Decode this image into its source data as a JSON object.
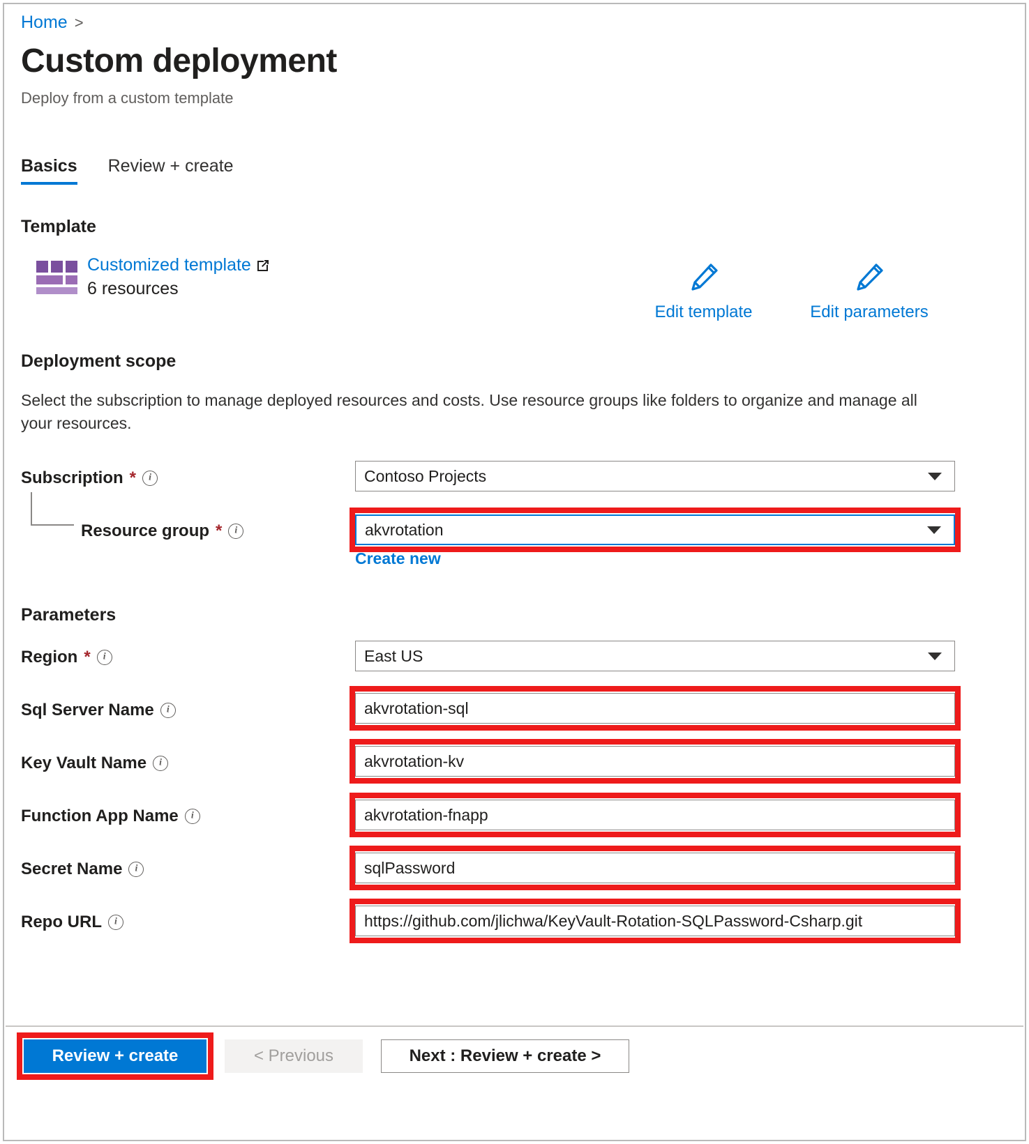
{
  "breadcrumb": {
    "home_label": "Home",
    "separator": ">"
  },
  "header": {
    "title": "Custom deployment",
    "subtitle": "Deploy from a custom template"
  },
  "tabs": [
    {
      "label": "Basics",
      "selected": true
    },
    {
      "label": "Review + create",
      "selected": false
    }
  ],
  "template_section": {
    "heading": "Template",
    "icon_name": "customized-template-icon",
    "link_label": "Customized template",
    "external_link_icon": "external-link-icon",
    "resources_count_label": "6 resources",
    "actions": [
      {
        "icon": "pencil-icon",
        "label": "Edit template"
      },
      {
        "icon": "pencil-icon",
        "label": "Edit parameters"
      }
    ]
  },
  "deployment_scope": {
    "heading": "Deployment scope",
    "description": "Select the subscription to manage deployed resources and costs. Use resource groups like folders to organize and manage all your resources.",
    "subscription": {
      "label": "Subscription",
      "required_marker": "*",
      "info_icon": "info-icon",
      "value": "Contoso Projects",
      "chevron_icon": "chevron-down-icon",
      "highlighted": false
    },
    "resource_group": {
      "label": "Resource group",
      "required_marker": "*",
      "info_icon": "info-icon",
      "value": "akvrotation",
      "chevron_icon": "chevron-down-icon",
      "focused": true,
      "highlighted": true,
      "create_new_label": "Create new"
    }
  },
  "parameters_section": {
    "heading": "Parameters",
    "fields": [
      {
        "label": "Region",
        "required_marker": "*",
        "info_icon": "info-icon",
        "value": "East US",
        "type": "select",
        "chevron_icon": "chevron-down-icon",
        "highlighted": false
      },
      {
        "label": "Sql Server Name",
        "required_marker": "",
        "info_icon": "info-icon",
        "value": "akvrotation-sql",
        "type": "text",
        "highlighted": true
      },
      {
        "label": "Key Vault Name",
        "required_marker": "",
        "info_icon": "info-icon",
        "value": "akvrotation-kv",
        "type": "text",
        "highlighted": true
      },
      {
        "label": "Function App Name",
        "required_marker": "",
        "info_icon": "info-icon",
        "value": "akvrotation-fnapp",
        "type": "text",
        "highlighted": true
      },
      {
        "label": "Secret Name",
        "required_marker": "",
        "info_icon": "info-icon",
        "value": "sqlPassword",
        "type": "text",
        "highlighted": true
      },
      {
        "label": "Repo URL",
        "required_marker": "",
        "info_icon": "info-icon",
        "value": "https://github.com/jlichwa/KeyVault-Rotation-SQLPassword-Csharp.git",
        "type": "text",
        "highlighted": true
      }
    ]
  },
  "footer": {
    "review_create_label": "Review + create",
    "previous_label": "< Previous",
    "next_label": "Next : Review + create >",
    "review_create_highlighted": true
  },
  "colors": {
    "accent_blue": "#0078d4",
    "annotation_red": "#ee1b1b",
    "required_red": "#a4262c",
    "template_icon_purple_dark": "#7a4f9e",
    "template_icon_purple_mid": "#9a6cb4",
    "template_icon_purple_light": "#b08ec9"
  }
}
